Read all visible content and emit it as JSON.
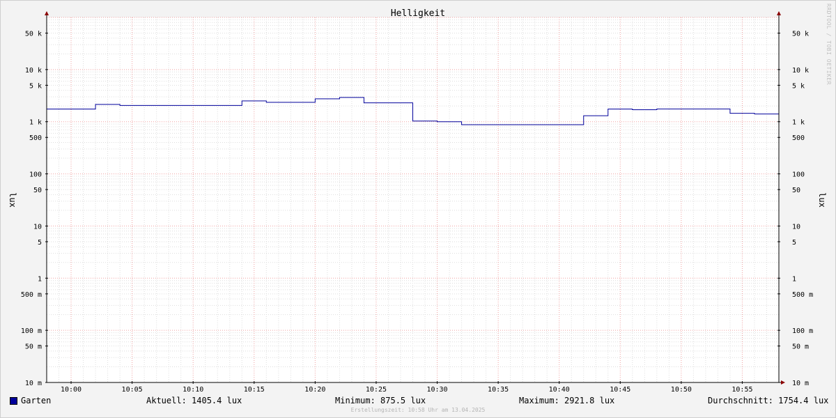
{
  "chart_data": {
    "type": "line",
    "title": "Helligkeit",
    "ylabel_left": "lux",
    "ylabel_right": "lux",
    "yscale": "log",
    "ylim": [
      0.01,
      100000
    ],
    "xlim": [
      "09:58",
      "10:58"
    ],
    "y_ticks": [
      {
        "value": 50000,
        "label": "50 k"
      },
      {
        "value": 10000,
        "label": "10 k"
      },
      {
        "value": 5000,
        "label": "5 k"
      },
      {
        "value": 1000,
        "label": "1 k"
      },
      {
        "value": 500,
        "label": "500"
      },
      {
        "value": 100,
        "label": "100"
      },
      {
        "value": 50,
        "label": "50"
      },
      {
        "value": 10,
        "label": "10"
      },
      {
        "value": 5,
        "label": "5"
      },
      {
        "value": 1,
        "label": "1"
      },
      {
        "value": 0.5,
        "label": "500 m"
      },
      {
        "value": 0.1,
        "label": "100 m"
      },
      {
        "value": 0.05,
        "label": "50 m"
      },
      {
        "value": 0.01,
        "label": "10 m"
      }
    ],
    "x_ticks": [
      "10:00",
      "10:05",
      "10:10",
      "10:15",
      "10:20",
      "10:25",
      "10:30",
      "10:35",
      "10:40",
      "10:45",
      "10:50",
      "10:55"
    ],
    "grid": true,
    "series": [
      {
        "name": "Garten",
        "color": "#00009b",
        "step": true,
        "points": [
          {
            "t": "09:58",
            "v": 1750
          },
          {
            "t": "10:02",
            "v": 2150
          },
          {
            "t": "10:04",
            "v": 2050
          },
          {
            "t": "10:14",
            "v": 2500
          },
          {
            "t": "10:16",
            "v": 2350
          },
          {
            "t": "10:20",
            "v": 2750
          },
          {
            "t": "10:22",
            "v": 2920
          },
          {
            "t": "10:24",
            "v": 2300
          },
          {
            "t": "10:28",
            "v": 1030
          },
          {
            "t": "10:30",
            "v": 1000
          },
          {
            "t": "10:32",
            "v": 875.5
          },
          {
            "t": "10:42",
            "v": 1300
          },
          {
            "t": "10:44",
            "v": 1750
          },
          {
            "t": "10:46",
            "v": 1700
          },
          {
            "t": "10:48",
            "v": 1760
          },
          {
            "t": "10:54",
            "v": 1450
          },
          {
            "t": "10:56",
            "v": 1405.4
          }
        ]
      }
    ]
  },
  "legend": {
    "series_name": "Garten",
    "current": "Aktuell: 1405.4 lux",
    "minimum": "Minimum: 875.5 lux",
    "maximum": "Maximum: 2921.8 lux",
    "average": "Durchschnitt: 1754.4 lux"
  },
  "footer": "Erstellungszeit: 10:58 Uhr am 13.04.2025",
  "watermark": "RRDTOOL / TOBI OETIKER"
}
